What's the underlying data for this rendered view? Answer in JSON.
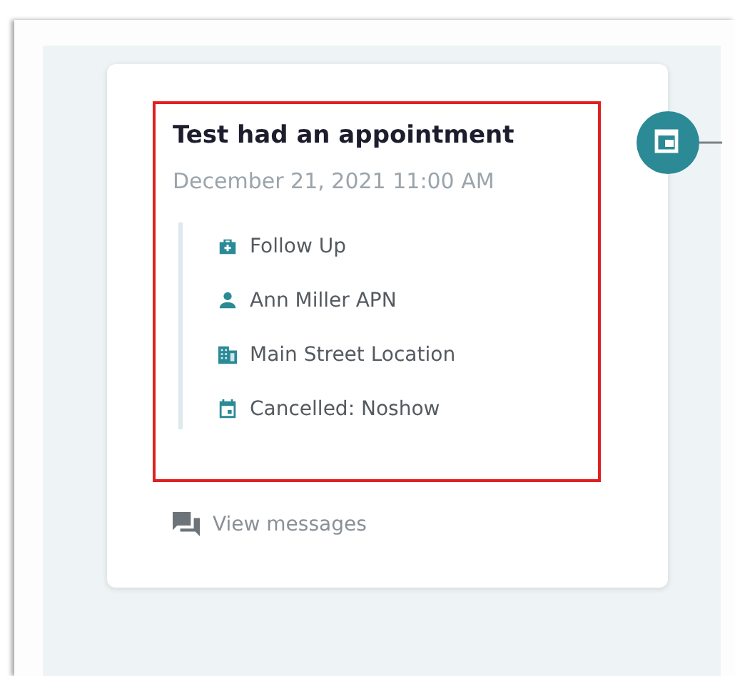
{
  "event": {
    "title": "Test had an appointment",
    "date": "December 21, 2021 11:00 AM",
    "highlighted": true,
    "details": [
      {
        "kind": "visit-type",
        "text": "Follow Up"
      },
      {
        "kind": "provider",
        "text": "Ann Miller APN"
      },
      {
        "kind": "location",
        "text": "Main Street Location"
      },
      {
        "kind": "status",
        "text": "Cancelled: Noshow"
      }
    ],
    "link": "View messages"
  }
}
